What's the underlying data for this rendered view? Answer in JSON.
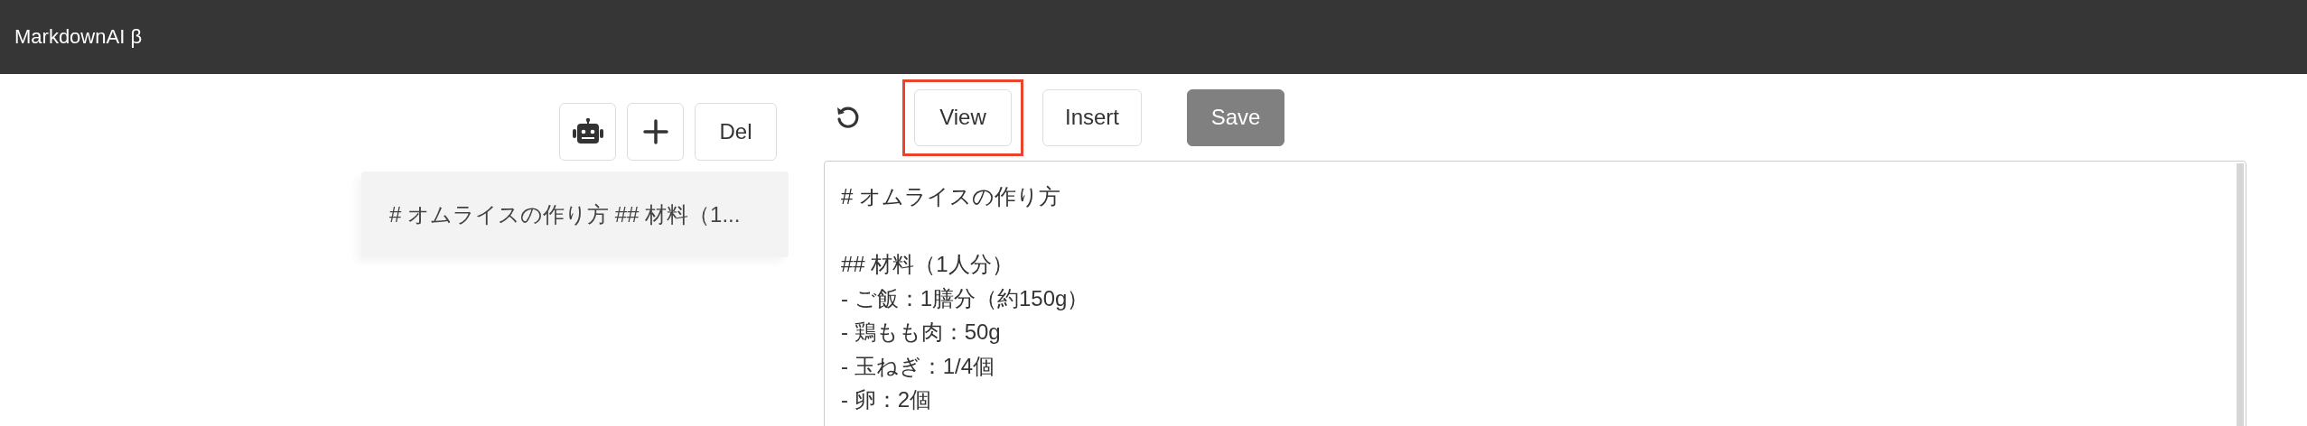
{
  "app_bar": {
    "title": "MarkdownAI β"
  },
  "sidebar": {
    "buttons": [
      {
        "kind": "robot"
      },
      {
        "kind": "add"
      },
      {
        "kind": "text",
        "label": "Del"
      }
    ],
    "notes": [
      {
        "preview": "# オムライスの作り方 ## 材料（1...",
        "selected": true
      }
    ]
  },
  "editor": {
    "toolbar": [
      {
        "kind": "undo"
      },
      {
        "kind": "text",
        "label": "View",
        "highlighted": true,
        "primary": false
      },
      {
        "kind": "text",
        "label": "Insert",
        "highlighted": false,
        "primary": false
      },
      {
        "kind": "text",
        "label": "Save",
        "highlighted": false,
        "primary": true
      }
    ],
    "value": "# オムライスの作り方\n\n## 材料（1人分）\n- ご飯：1膳分（約150g）\n- 鶏もも肉：50g\n- 玉ねぎ：1/4個\n- 卵：2個"
  }
}
